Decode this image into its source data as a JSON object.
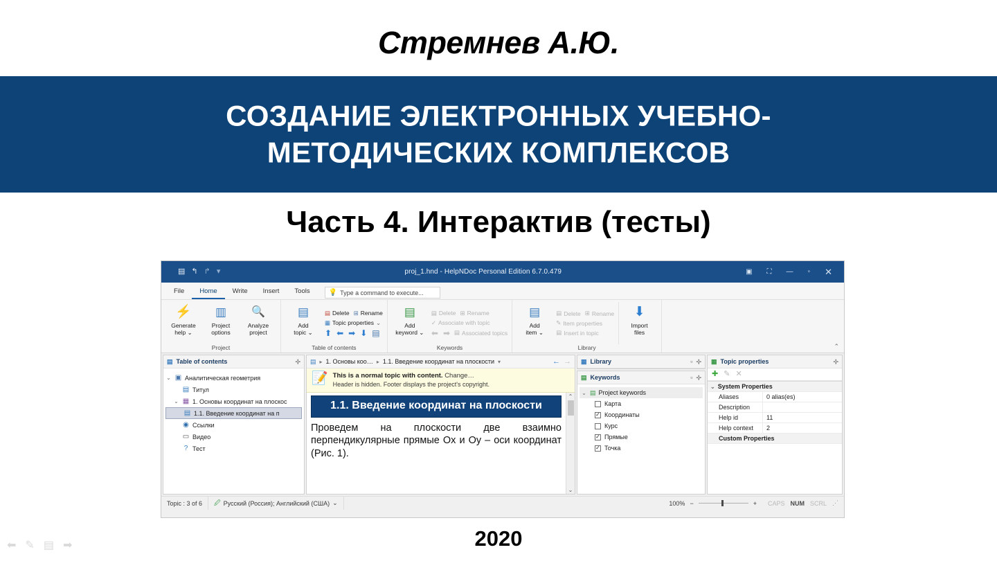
{
  "slide": {
    "author": "Стремнев А.Ю.",
    "band_line1": "СОЗДАНИЕ ЭЛЕКТРОННЫХ УЧЕБНО-",
    "band_line2": "МЕТОДИЧЕСКИХ КОМПЛЕКСОВ",
    "subtitle": "Часть 4. Интерактив (тесты)",
    "year": "2020",
    "band_color": "#0d4377",
    "nav_icons": [
      "prev-arrow-icon",
      "pen-icon",
      "menu-icon",
      "next-arrow-icon"
    ]
  },
  "app": {
    "titlebar": {
      "title": "proj_1.hnd - HelpNDoc Personal Edition 6.7.0.479",
      "qat": [
        "save-icon",
        "undo-icon",
        "redo-icon",
        "customize-icon"
      ],
      "save_glyph": "▤",
      "undo_glyph": "↰",
      "redo_glyph": "↱",
      "dropdown_glyph": "▾",
      "help_glyph": "▣",
      "ribbon_display_glyph": "⛶",
      "minimize_glyph": "—",
      "maximize_glyph": "▫",
      "close_glyph": "✕"
    },
    "tabs": [
      {
        "label": "File",
        "active": false
      },
      {
        "label": "Home",
        "active": true
      },
      {
        "label": "Write",
        "active": false
      },
      {
        "label": "Insert",
        "active": false
      },
      {
        "label": "Tools",
        "active": false
      }
    ],
    "command_search": {
      "placeholder": "Type a command to execute...",
      "icon": "lightbulb-icon"
    },
    "ribbon": {
      "collapse_glyph": "⌃",
      "groups": [
        {
          "label": "Project",
          "big_buttons": [
            {
              "label": "Generate\nhelp ⌄",
              "icon": "lightning-gear-icon",
              "glyph": "⚡"
            },
            {
              "label": "Project\noptions",
              "icon": "sliders-icon",
              "glyph": "▥"
            },
            {
              "label": "Analyze\nproject",
              "icon": "magnifier-icon",
              "glyph": "🔍"
            }
          ]
        },
        {
          "label": "Table of contents",
          "big_buttons": [
            {
              "label": "Add\ntopic ⌄",
              "icon": "add-topic-icon",
              "glyph": "▤"
            }
          ],
          "items": [
            {
              "label": "Delete",
              "icon": "delete-icon",
              "disabled": false
            },
            {
              "label": "Rename",
              "icon": "rename-icon",
              "disabled": false
            },
            {
              "label": "Topic properties",
              "icon": "topic-properties-icon",
              "disabled": false,
              "dropdown": true
            }
          ],
          "arrows": [
            "up-arrow",
            "left-arrow",
            "right-arrow",
            "down-arrow",
            "list-icon"
          ]
        },
        {
          "label": "Keywords",
          "big_buttons": [
            {
              "label": "Add\nkeyword ⌄",
              "icon": "add-keyword-icon",
              "glyph": "▤"
            }
          ],
          "items": [
            {
              "label": "Delete",
              "icon": "delete-icon",
              "disabled": true
            },
            {
              "label": "Rename",
              "icon": "rename-icon",
              "disabled": true
            },
            {
              "label": "Associate with topic",
              "icon": "check-icon",
              "disabled": true
            },
            {
              "label": "Associated topics",
              "icon": "list-icon",
              "disabled": true
            }
          ]
        },
        {
          "label": "Library",
          "big_buttons": [
            {
              "label": "Add\nitem ⌄",
              "icon": "add-item-icon",
              "glyph": "▤"
            }
          ],
          "items": [
            {
              "label": "Delete",
              "icon": "delete-icon",
              "disabled": true
            },
            {
              "label": "Rename",
              "icon": "rename-icon",
              "disabled": true
            },
            {
              "label": "Item properties",
              "icon": "properties-icon",
              "disabled": true
            },
            {
              "label": "Insert in topic",
              "icon": "insert-icon",
              "disabled": true
            }
          ],
          "trailing_button": {
            "label": "Import\nfiles",
            "icon": "import-files-icon",
            "glyph": "⬇"
          }
        }
      ]
    },
    "toc_panel": {
      "title": "Table of contents",
      "icon": "toc-icon",
      "pin_glyph": "⊹",
      "items": [
        {
          "label": "Аналитическая геометрия",
          "level": 0,
          "twisty": "⌄",
          "icon": "book-root-icon",
          "glyph": "▣",
          "selected": false
        },
        {
          "label": "Титул",
          "level": 1,
          "twisty": "",
          "icon": "topic-icon",
          "glyph": "▤",
          "selected": false
        },
        {
          "label": "1. Основы координат на плоскос",
          "level": 1,
          "twisty": "⌄",
          "icon": "folder-topic-icon",
          "glyph": "▦",
          "selected": false
        },
        {
          "label": "1.1. Введение координат на п",
          "level": 2,
          "twisty": "",
          "icon": "topic-icon",
          "glyph": "▤",
          "selected": true
        },
        {
          "label": "Ссылки",
          "level": 1,
          "twisty": "",
          "icon": "links-icon",
          "glyph": "◉",
          "selected": false
        },
        {
          "label": "Видео",
          "level": 1,
          "twisty": "",
          "icon": "video-icon",
          "glyph": "▭",
          "selected": false
        },
        {
          "label": "Тест",
          "level": 1,
          "twisty": "",
          "icon": "test-icon",
          "glyph": "?",
          "selected": false
        }
      ]
    },
    "editor": {
      "breadcrumb": {
        "icon": "topic-icon",
        "crumb1": "1. Основы коо…",
        "crumb2": "1.1. Введение координат на плоскости",
        "sep": "▸",
        "dropdown_glyph": "▾",
        "back_glyph": "←",
        "forward_glyph": "→"
      },
      "notice": {
        "icon": "page-pencil-icon",
        "bold": "This is a normal topic with content.",
        "change_link": "Change…",
        "line2": "Header is hidden.   Footer displays the project's copyright."
      },
      "heading": "1.1. Введение координат на плоскости",
      "paragraph": "Проведем на плоскости две взаимно перпендикулярные прямые Ox и Oy – оси координат (Рис. 1).",
      "scroll_up_glyph": "⌃",
      "scroll_down_glyph": "⌄"
    },
    "library_panel": {
      "title": "Library",
      "icon": "library-icon",
      "restore_glyph": "▫",
      "pin_glyph": "⊹"
    },
    "keywords_panel": {
      "title": "Keywords",
      "icon": "keywords-icon",
      "restore_glyph": "▫",
      "pin_glyph": "⊹",
      "root": {
        "label": "Project keywords",
        "twisty": "⌄",
        "icon": "keywords-root-icon"
      },
      "items": [
        {
          "label": "Карта",
          "checked": false
        },
        {
          "label": "Координаты",
          "checked": true
        },
        {
          "label": "Курс",
          "checked": false
        },
        {
          "label": "Прямые",
          "checked": true
        },
        {
          "label": "Точка",
          "checked": true
        }
      ],
      "check_glyph": "✓"
    },
    "properties_panel": {
      "title": "Topic properties",
      "icon": "topic-properties-icon",
      "pin_glyph": "⊹",
      "toolbar": [
        {
          "name": "add-property-button",
          "glyph": "✚",
          "color": "#3ea93e",
          "disabled": false
        },
        {
          "name": "edit-property-button",
          "glyph": "✎",
          "color": "#b8b8b8",
          "disabled": true
        },
        {
          "name": "delete-property-button",
          "glyph": "✕",
          "color": "#b8b8b8",
          "disabled": true
        }
      ],
      "system_group": {
        "label": "System Properties",
        "twisty": "⌄"
      },
      "rows": [
        {
          "key": "Aliases",
          "value": "0 alias(es)"
        },
        {
          "key": "Description",
          "value": ""
        },
        {
          "key": "Help id",
          "value": "11"
        },
        {
          "key": "Help context",
          "value": "2"
        }
      ],
      "custom_group": {
        "label": "Custom Properties"
      }
    },
    "statusbar": {
      "topic_count": "Topic : 3 of 6",
      "language_icon": "spellcheck-icon",
      "language": "Русский (Россия); Английский (США)",
      "language_dropdown": "⌄",
      "zoom_value": "100%",
      "zoom_out_glyph": "−",
      "zoom_in_glyph": "+",
      "indicators": [
        {
          "label": "CAPS",
          "on": false
        },
        {
          "label": "NUM",
          "on": true
        },
        {
          "label": "SCRL",
          "on": false
        }
      ],
      "grip_glyph": "⋰"
    }
  }
}
